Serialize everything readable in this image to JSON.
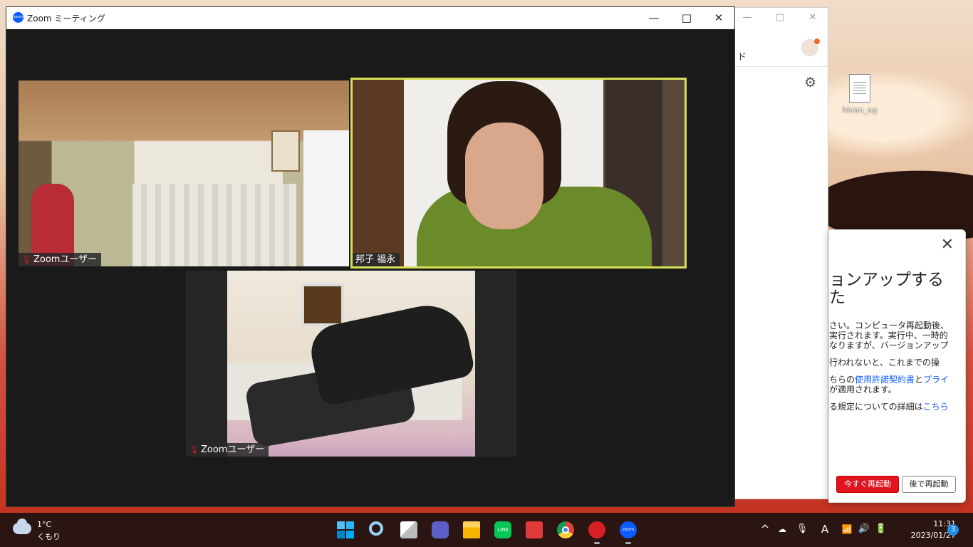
{
  "zoom_window": {
    "title": "Zoom ミーティング",
    "logo_text": "zoom",
    "controls": {
      "minimize": "—",
      "maximize": "□",
      "close": "✕"
    }
  },
  "participants": [
    {
      "name": "Zoomユーザー",
      "muted": true
    },
    {
      "name": "邦子 福永",
      "muted": false,
      "active_speaker": true
    },
    {
      "name": "Zoomユーザー",
      "muted": true
    }
  ],
  "background_window": {
    "controls": {
      "minimize": "—",
      "maximize": "□",
      "close": "✕"
    },
    "fragment_text": "ド"
  },
  "update_dialog": {
    "close": "✕",
    "title": "ョンアップする\nた",
    "p1": "さい。コンピュータ再起動後、実行されます。実行中、一時的なりますが、バージョンアップ",
    "p2": "行われないと、これまでの操",
    "p3_a": "ちらの",
    "p3_link1": "使用許諾契約書",
    "p3_b": "と",
    "p3_link2": "プライ",
    "p3_c": "が適用されます。",
    "p4_a": "る規定についての詳細は",
    "p4_link": "こちら",
    "btn_restart_now": "今すぐ再起動",
    "btn_restart_later": "後で再起動"
  },
  "desktop": {
    "icon_label": "hicon_og"
  },
  "taskbar": {
    "weather_temp": "1°C",
    "weather_condition": "くもり",
    "apps": [
      "start-icon",
      "search-icon",
      "task-view-icon",
      "teams-icon",
      "file-explorer-icon",
      "line-icon",
      "gift-icon",
      "chrome-icon",
      "trend-micro-icon",
      "zoom-icon"
    ],
    "line_text": "LINE",
    "zoom_text": "zoom",
    "tray": {
      "chevron": "^",
      "mic": "🎙",
      "ime": "A",
      "wifi": "📶",
      "volume": "🔊",
      "battery": "🔋"
    },
    "time": "11:31",
    "date": "2023/01/27",
    "notifications": "3"
  }
}
